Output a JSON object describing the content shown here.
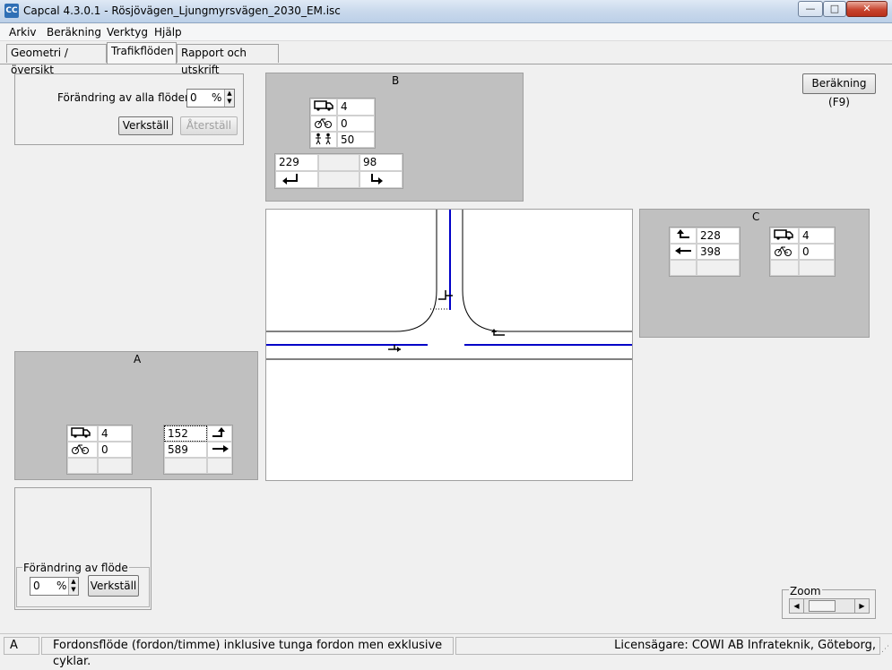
{
  "window": {
    "title": "Capcal 4.3.0.1 - Rösjövägen_Ljungmyrsvägen_2030_EM.isc",
    "minimize": "—",
    "maximize": "□",
    "close": "✕"
  },
  "menu": [
    "Arkiv",
    "Beräkning",
    "Verktyg",
    "Hjälp"
  ],
  "tabs": [
    {
      "label": "Geometri / översikt",
      "active": false
    },
    {
      "label": "Trafikflöden",
      "active": true
    },
    {
      "label": "Rapport och utskrift",
      "active": false
    }
  ],
  "all_flows": {
    "label": "Förändring av alla flöden:",
    "value": "0",
    "unit": "%",
    "apply": "Verkställ",
    "reset": "Återställ"
  },
  "calc_button": "Beräkning (F9)",
  "arm_b": {
    "name": "B",
    "heavy": "4",
    "bikes": "0",
    "pedestrians": "50",
    "left_flow": "229",
    "right_flow": "98"
  },
  "arm_c": {
    "name": "C",
    "left_flow": "228",
    "through_flow": "398",
    "heavy": "4",
    "bikes": "0"
  },
  "arm_a": {
    "name": "A",
    "heavy": "4",
    "bikes": "0",
    "left_flow": "152",
    "through_flow": "589"
  },
  "flow_change": {
    "label": "Förändring av flöde",
    "value": "0",
    "unit": "%",
    "apply": "Verkställ"
  },
  "zoom": {
    "label": "Zoom"
  },
  "status": {
    "arm": "A",
    "message": "Fordonsflöde (fordon/timme) inklusive tunga fordon men exklusive cyklar.",
    "license": "Licensägare: COWI AB Infrateknik, Göteborg,"
  },
  "colors": {
    "lane": "#0000c8",
    "panel_gray": "#c0c0c0"
  }
}
